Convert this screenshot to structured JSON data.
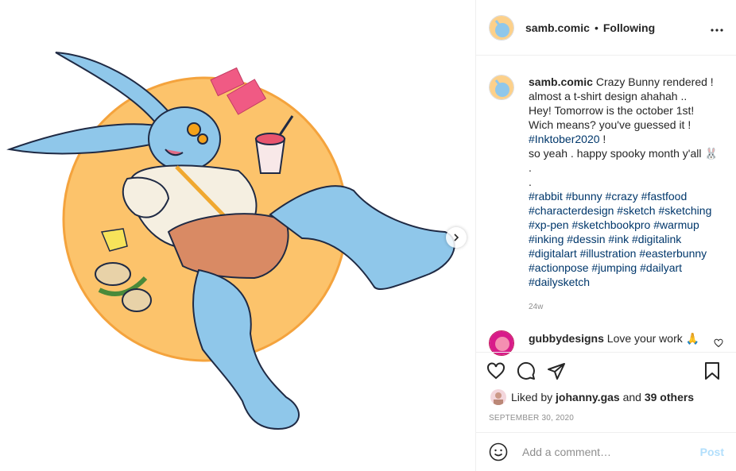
{
  "header": {
    "username": "samb.comic",
    "separator": "•",
    "follow_status": "Following",
    "more_icon": "more-horizontal-icon"
  },
  "caption": {
    "username": "samb.comic",
    "line1": "Crazy Bunny rendered ! almost a t-shirt design ahahah ..",
    "line2": "Hey! Tomorrow is the october 1st!",
    "line3": "Wich means? you've guessed it !",
    "line4_tag": "#Inktober2020",
    "line4_rest": " !",
    "line5": "so yeah . happy spooky month y'all 🐰",
    "dot1": ".",
    "dot2": ".",
    "hashtags": [
      "#rabbit",
      "#bunny",
      "#crazy",
      "#fastfood",
      "#characterdesign",
      "#sketch",
      "#sketching",
      "#xp-pen",
      "#sketchbookpro",
      "#warmup",
      "#inking",
      "#dessin",
      "#ink",
      "#digitalink",
      "#digitalart",
      "#illustration",
      "#easterbunny",
      "#actionpose",
      "#jumping",
      "#dailyart",
      "#dailysketch"
    ],
    "time_ago": "24w"
  },
  "comment": {
    "username": "gubbydesigns",
    "text": "Love your work 🙏"
  },
  "likes": {
    "prefix": "Liked by ",
    "user": "johanny.gas",
    "mid": " and ",
    "others": "39 others"
  },
  "date": "SEPTEMBER 30, 2020",
  "add_comment": {
    "placeholder": "Add a comment…",
    "post_label": "Post"
  },
  "colors": {
    "link": "#00376b",
    "post_disabled": "#b2dffc",
    "circle": "#fcc36b",
    "bunny": "#8fc7ea"
  }
}
